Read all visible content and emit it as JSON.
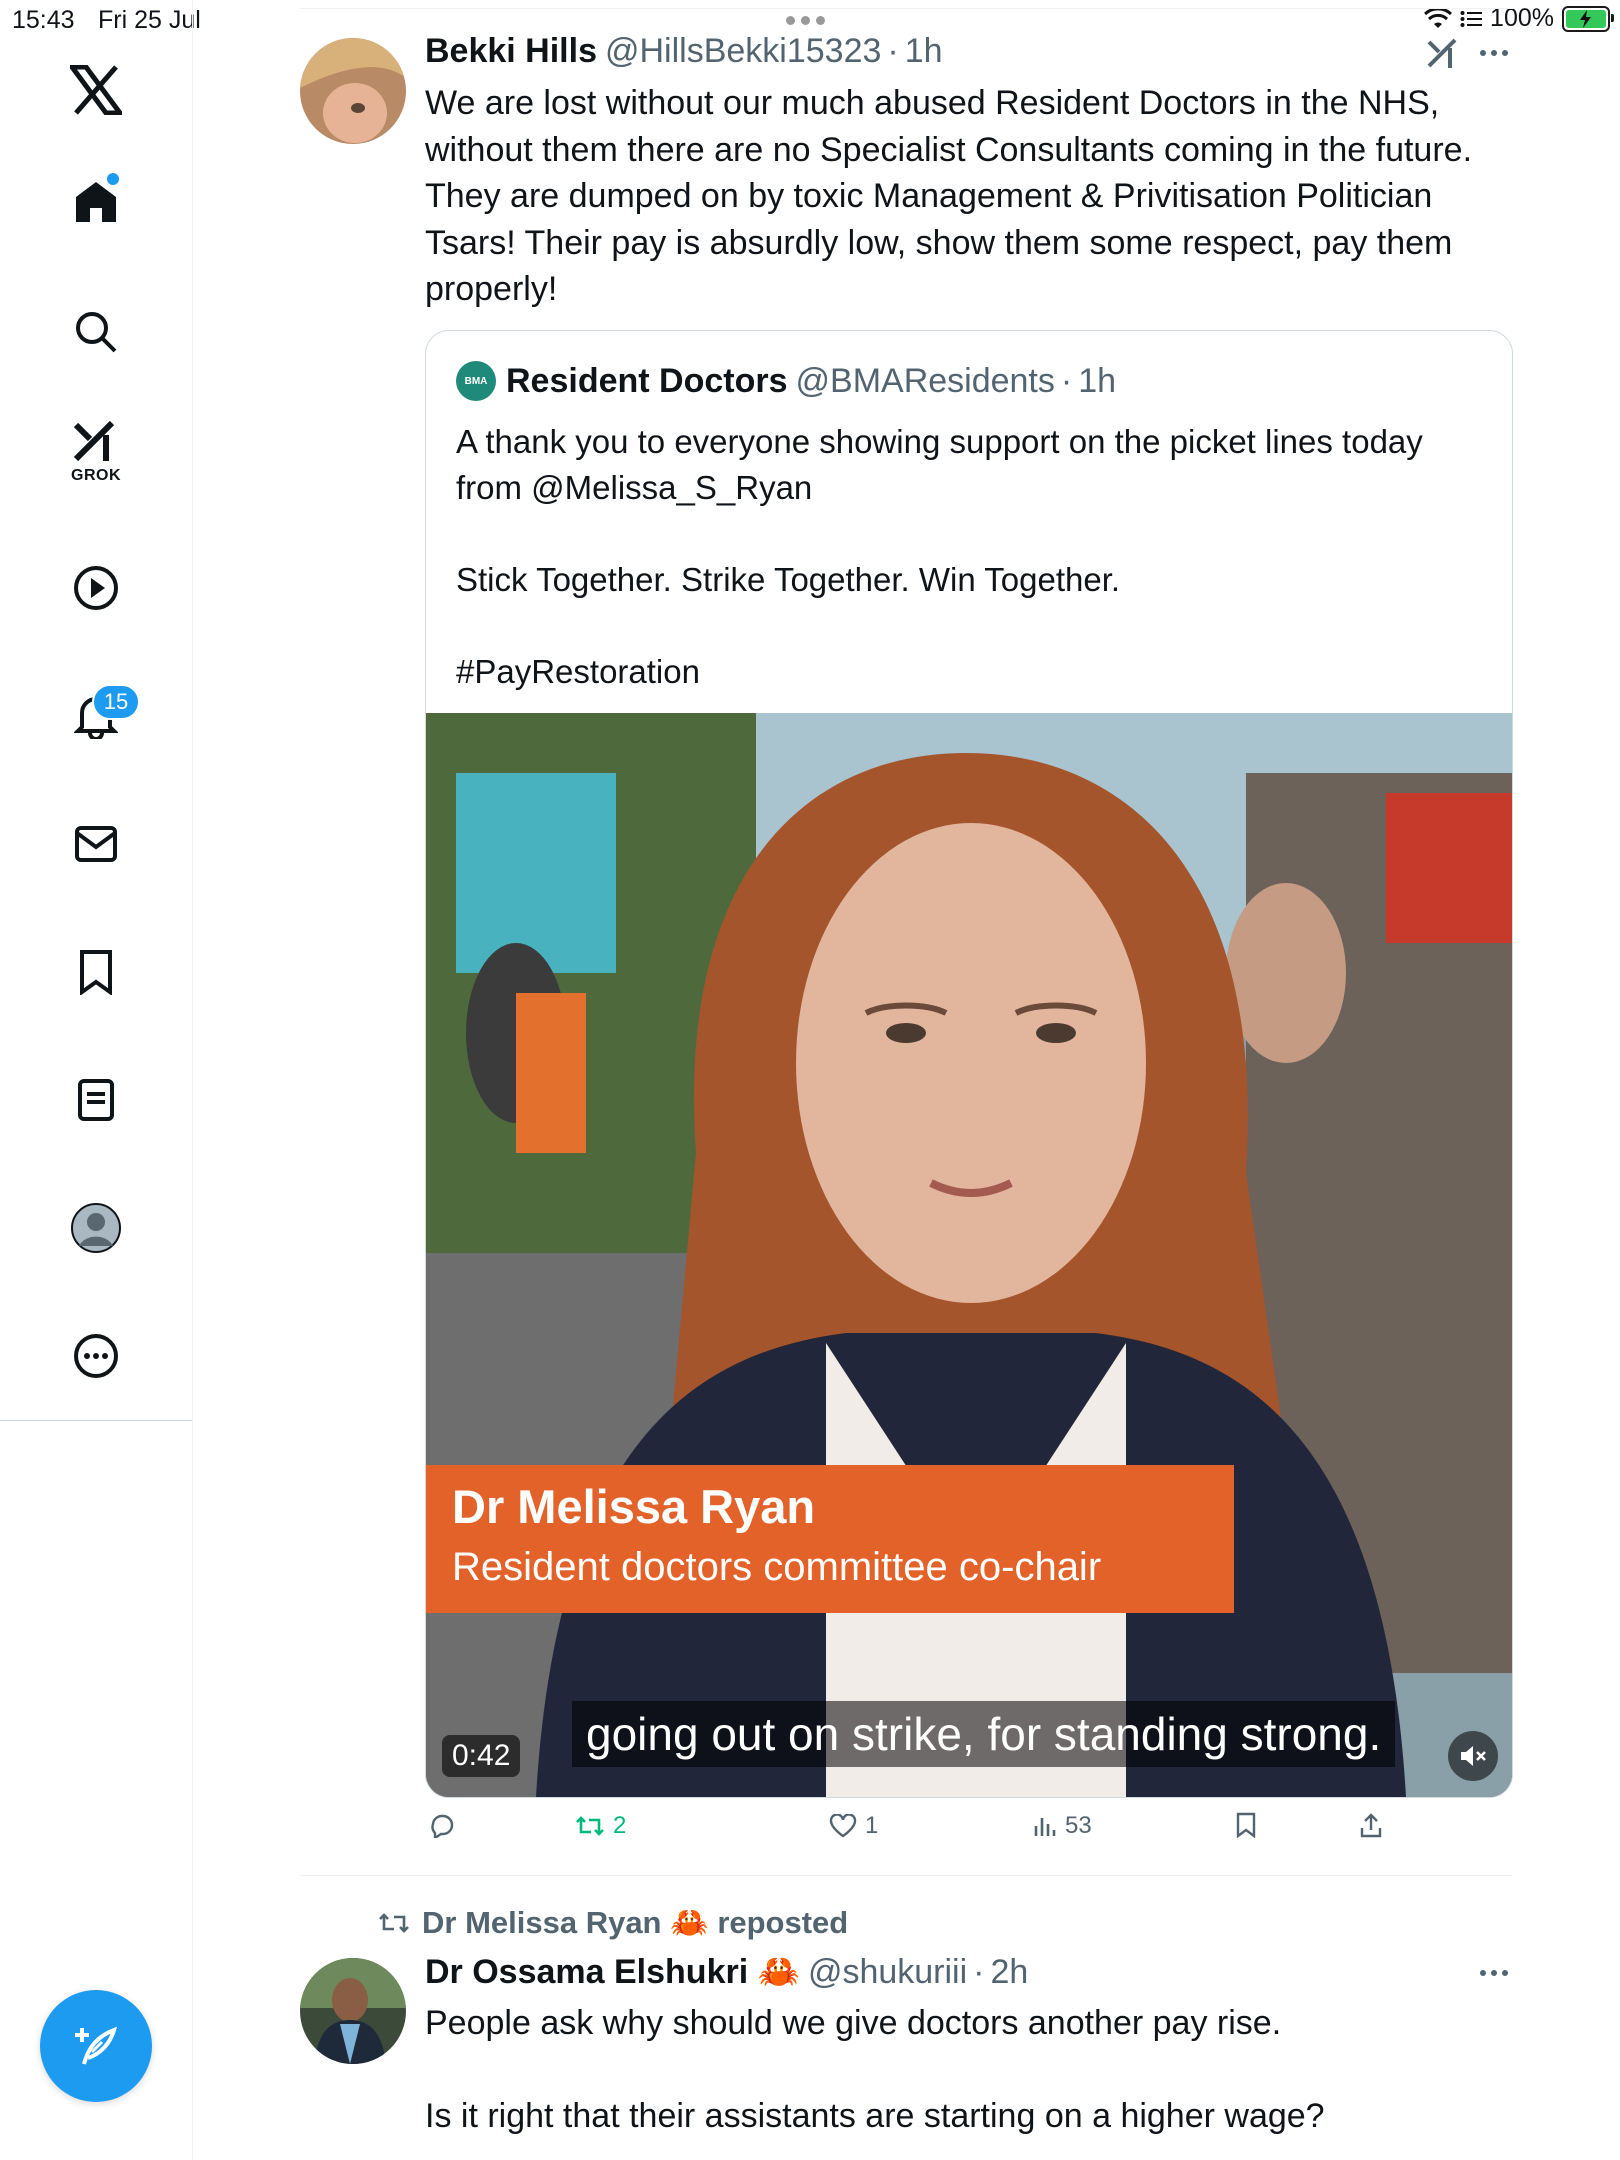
{
  "status_bar": {
    "time": "15:43",
    "date": "Fri 25 Jul",
    "battery": "100%"
  },
  "sidebar": {
    "items": [
      {
        "name": "x-logo"
      },
      {
        "name": "home",
        "has_dot": true
      },
      {
        "name": "explore"
      },
      {
        "name": "grok",
        "label": "GROK"
      },
      {
        "name": "video"
      },
      {
        "name": "notifications",
        "badge": "15"
      },
      {
        "name": "messages"
      },
      {
        "name": "bookmarks"
      },
      {
        "name": "lists"
      },
      {
        "name": "profile"
      },
      {
        "name": "more"
      }
    ],
    "compose_label": "+"
  },
  "post1": {
    "author_name": "Bekki Hills",
    "handle": "@HillsBekki15323",
    "time": "1h",
    "lines": [
      "We are lost without our much abused Resident Doctors in the NHS,",
      "without them there are no Specialist Consultants coming in the future.",
      "They are dumped on by toxic Management & Privitisation Politician",
      "Tsars! Their pay is absurdly low, show them some respect, pay them",
      "properly!"
    ],
    "quote": {
      "logo_text": "BMA",
      "author_name": "Resident Doctors",
      "handle": "@BMAResidents",
      "time": "1h",
      "text": "A thank you to everyone showing support on the picket lines today\nfrom @Melissa_S_Ryan\n\nStick Together. Strike Together. Win Together.\n\n#PayRestoration",
      "video": {
        "name_title": "Dr Melissa Ryan",
        "role": "Resident doctors committee co-chair",
        "subtitle": "going out on strike, for standing strong.",
        "duration": "0:42"
      }
    },
    "actions": {
      "replies": "",
      "reposts": "2",
      "likes": "1",
      "views": "53"
    }
  },
  "post2": {
    "repost_by": "Dr Melissa Ryan 🦀 reposted",
    "author_name": "Dr Ossama Elshukri 🦀",
    "handle": "@shukuriii",
    "time": "2h",
    "line1": "People ask why should we give doctors another pay rise.",
    "line2": "Is it right that their assistants are starting on a higher wage?"
  },
  "colors": {
    "accent": "#1d9bf0",
    "repost_green": "#00ba7c",
    "muted_text": "#536471",
    "lower_third": "#e3622a"
  }
}
